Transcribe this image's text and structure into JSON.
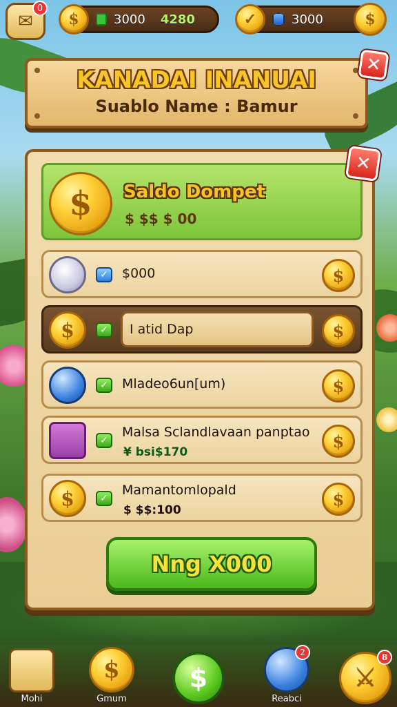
{
  "topbar": {
    "home_badge": "0",
    "currency1_value": "3000",
    "currency1_secondary": "4280",
    "currency2_value": "3000"
  },
  "header": {
    "title": "KANADAI INANUAI",
    "subtitle": "Suablo Name : Bamur"
  },
  "wallet": {
    "title": "Saldo Dompet",
    "balance": "$ $$ $ 00"
  },
  "rows": [
    {
      "label": "$000",
      "sub": ""
    },
    {
      "label": "I atid Dap",
      "sub": ""
    },
    {
      "label": "Mladeo6un[um)",
      "sub": ""
    },
    {
      "label": "Malsa Sclandlavaan panptao",
      "sub": "¥ bsi$170"
    },
    {
      "label": "Mamantomlopald",
      "sub": "$ $$:100"
    }
  ],
  "cta_label": "Nng X000",
  "bottom_nav": [
    {
      "label": "Mohi"
    },
    {
      "label": "Gmum"
    },
    {
      "label": ""
    },
    {
      "label": "Reabci",
      "badge": "2"
    },
    {
      "label": "",
      "badge": "8"
    }
  ],
  "icons": {
    "coin": "coin-icon",
    "close": "close-icon",
    "check": "check-icon"
  },
  "colors": {
    "accent_green": "#4cb81c",
    "gold": "#ffd23a",
    "wood": "#8a5a22",
    "close_red": "#d8261c"
  }
}
